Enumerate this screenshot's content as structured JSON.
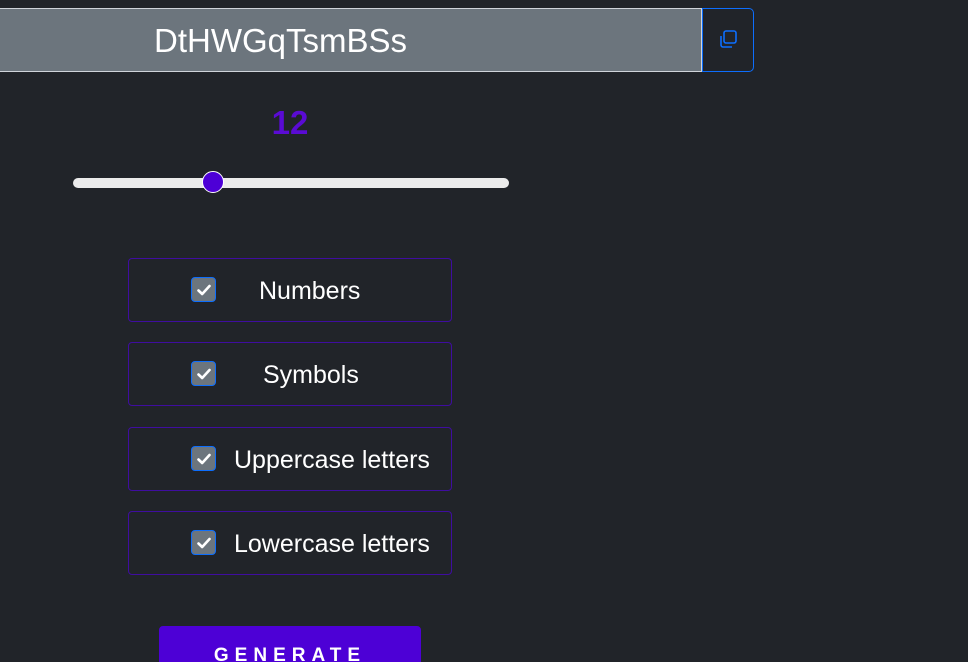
{
  "password": {
    "value": "DtHWGqTsmBSs",
    "copy_icon": "copy-icon"
  },
  "length": {
    "value": "12",
    "slider_fraction": 0.32
  },
  "options": [
    {
      "label": "Numbers",
      "checked": true
    },
    {
      "label": "Symbols",
      "checked": true
    },
    {
      "label": "Uppercase letters",
      "checked": true
    },
    {
      "label": "Lowercase letters",
      "checked": true
    }
  ],
  "generate_label": "GENERATE",
  "colors": {
    "background": "#212429",
    "accent": "#4d00d6",
    "field": "#6c757d",
    "copy_border": "#0d6efd"
  }
}
